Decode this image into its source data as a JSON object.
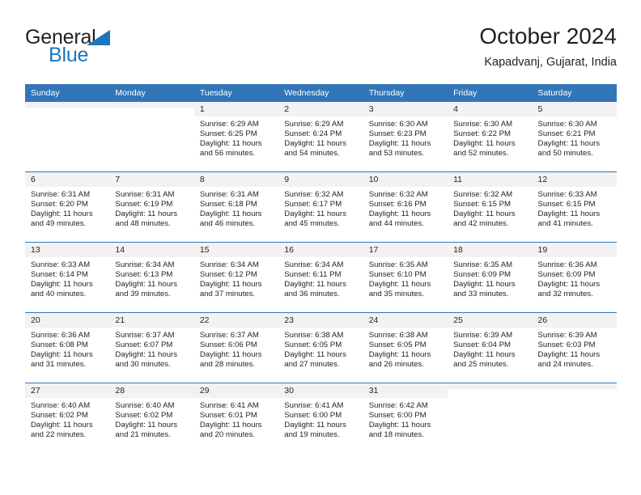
{
  "brand": {
    "name_part1": "General",
    "name_part2": "Blue",
    "accent_color": "#1d76bc",
    "triangle_icon": "brand-triangle-icon"
  },
  "header": {
    "title": "October 2024",
    "subtitle": "Kapadvanj, Gujarat, India"
  },
  "theme": {
    "header_blue": "#3276b8",
    "date_band_gray": "#f2f2f2",
    "text": "#231f20"
  },
  "columns": [
    "Sunday",
    "Monday",
    "Tuesday",
    "Wednesday",
    "Thursday",
    "Friday",
    "Saturday"
  ],
  "weeks": [
    [
      {
        "day": "",
        "empty": true,
        "sunrise": "",
        "sunset": "",
        "daylight1": "",
        "daylight2": ""
      },
      {
        "day": "",
        "empty": true,
        "sunrise": "",
        "sunset": "",
        "daylight1": "",
        "daylight2": ""
      },
      {
        "day": "1",
        "sunrise": "Sunrise: 6:29 AM",
        "sunset": "Sunset: 6:25 PM",
        "daylight1": "Daylight: 11 hours",
        "daylight2": "and 56 minutes."
      },
      {
        "day": "2",
        "sunrise": "Sunrise: 6:29 AM",
        "sunset": "Sunset: 6:24 PM",
        "daylight1": "Daylight: 11 hours",
        "daylight2": "and 54 minutes."
      },
      {
        "day": "3",
        "sunrise": "Sunrise: 6:30 AM",
        "sunset": "Sunset: 6:23 PM",
        "daylight1": "Daylight: 11 hours",
        "daylight2": "and 53 minutes."
      },
      {
        "day": "4",
        "sunrise": "Sunrise: 6:30 AM",
        "sunset": "Sunset: 6:22 PM",
        "daylight1": "Daylight: 11 hours",
        "daylight2": "and 52 minutes."
      },
      {
        "day": "5",
        "sunrise": "Sunrise: 6:30 AM",
        "sunset": "Sunset: 6:21 PM",
        "daylight1": "Daylight: 11 hours",
        "daylight2": "and 50 minutes."
      }
    ],
    [
      {
        "day": "6",
        "sunrise": "Sunrise: 6:31 AM",
        "sunset": "Sunset: 6:20 PM",
        "daylight1": "Daylight: 11 hours",
        "daylight2": "and 49 minutes."
      },
      {
        "day": "7",
        "sunrise": "Sunrise: 6:31 AM",
        "sunset": "Sunset: 6:19 PM",
        "daylight1": "Daylight: 11 hours",
        "daylight2": "and 48 minutes."
      },
      {
        "day": "8",
        "sunrise": "Sunrise: 6:31 AM",
        "sunset": "Sunset: 6:18 PM",
        "daylight1": "Daylight: 11 hours",
        "daylight2": "and 46 minutes."
      },
      {
        "day": "9",
        "sunrise": "Sunrise: 6:32 AM",
        "sunset": "Sunset: 6:17 PM",
        "daylight1": "Daylight: 11 hours",
        "daylight2": "and 45 minutes."
      },
      {
        "day": "10",
        "sunrise": "Sunrise: 6:32 AM",
        "sunset": "Sunset: 6:16 PM",
        "daylight1": "Daylight: 11 hours",
        "daylight2": "and 44 minutes."
      },
      {
        "day": "11",
        "sunrise": "Sunrise: 6:32 AM",
        "sunset": "Sunset: 6:15 PM",
        "daylight1": "Daylight: 11 hours",
        "daylight2": "and 42 minutes."
      },
      {
        "day": "12",
        "sunrise": "Sunrise: 6:33 AM",
        "sunset": "Sunset: 6:15 PM",
        "daylight1": "Daylight: 11 hours",
        "daylight2": "and 41 minutes."
      }
    ],
    [
      {
        "day": "13",
        "sunrise": "Sunrise: 6:33 AM",
        "sunset": "Sunset: 6:14 PM",
        "daylight1": "Daylight: 11 hours",
        "daylight2": "and 40 minutes."
      },
      {
        "day": "14",
        "sunrise": "Sunrise: 6:34 AM",
        "sunset": "Sunset: 6:13 PM",
        "daylight1": "Daylight: 11 hours",
        "daylight2": "and 39 minutes."
      },
      {
        "day": "15",
        "sunrise": "Sunrise: 6:34 AM",
        "sunset": "Sunset: 6:12 PM",
        "daylight1": "Daylight: 11 hours",
        "daylight2": "and 37 minutes."
      },
      {
        "day": "16",
        "sunrise": "Sunrise: 6:34 AM",
        "sunset": "Sunset: 6:11 PM",
        "daylight1": "Daylight: 11 hours",
        "daylight2": "and 36 minutes."
      },
      {
        "day": "17",
        "sunrise": "Sunrise: 6:35 AM",
        "sunset": "Sunset: 6:10 PM",
        "daylight1": "Daylight: 11 hours",
        "daylight2": "and 35 minutes."
      },
      {
        "day": "18",
        "sunrise": "Sunrise: 6:35 AM",
        "sunset": "Sunset: 6:09 PM",
        "daylight1": "Daylight: 11 hours",
        "daylight2": "and 33 minutes."
      },
      {
        "day": "19",
        "sunrise": "Sunrise: 6:36 AM",
        "sunset": "Sunset: 6:09 PM",
        "daylight1": "Daylight: 11 hours",
        "daylight2": "and 32 minutes."
      }
    ],
    [
      {
        "day": "20",
        "sunrise": "Sunrise: 6:36 AM",
        "sunset": "Sunset: 6:08 PM",
        "daylight1": "Daylight: 11 hours",
        "daylight2": "and 31 minutes."
      },
      {
        "day": "21",
        "sunrise": "Sunrise: 6:37 AM",
        "sunset": "Sunset: 6:07 PM",
        "daylight1": "Daylight: 11 hours",
        "daylight2": "and 30 minutes."
      },
      {
        "day": "22",
        "sunrise": "Sunrise: 6:37 AM",
        "sunset": "Sunset: 6:06 PM",
        "daylight1": "Daylight: 11 hours",
        "daylight2": "and 28 minutes."
      },
      {
        "day": "23",
        "sunrise": "Sunrise: 6:38 AM",
        "sunset": "Sunset: 6:05 PM",
        "daylight1": "Daylight: 11 hours",
        "daylight2": "and 27 minutes."
      },
      {
        "day": "24",
        "sunrise": "Sunrise: 6:38 AM",
        "sunset": "Sunset: 6:05 PM",
        "daylight1": "Daylight: 11 hours",
        "daylight2": "and 26 minutes."
      },
      {
        "day": "25",
        "sunrise": "Sunrise: 6:39 AM",
        "sunset": "Sunset: 6:04 PM",
        "daylight1": "Daylight: 11 hours",
        "daylight2": "and 25 minutes."
      },
      {
        "day": "26",
        "sunrise": "Sunrise: 6:39 AM",
        "sunset": "Sunset: 6:03 PM",
        "daylight1": "Daylight: 11 hours",
        "daylight2": "and 24 minutes."
      }
    ],
    [
      {
        "day": "27",
        "sunrise": "Sunrise: 6:40 AM",
        "sunset": "Sunset: 6:02 PM",
        "daylight1": "Daylight: 11 hours",
        "daylight2": "and 22 minutes."
      },
      {
        "day": "28",
        "sunrise": "Sunrise: 6:40 AM",
        "sunset": "Sunset: 6:02 PM",
        "daylight1": "Daylight: 11 hours",
        "daylight2": "and 21 minutes."
      },
      {
        "day": "29",
        "sunrise": "Sunrise: 6:41 AM",
        "sunset": "Sunset: 6:01 PM",
        "daylight1": "Daylight: 11 hours",
        "daylight2": "and 20 minutes."
      },
      {
        "day": "30",
        "sunrise": "Sunrise: 6:41 AM",
        "sunset": "Sunset: 6:00 PM",
        "daylight1": "Daylight: 11 hours",
        "daylight2": "and 19 minutes."
      },
      {
        "day": "31",
        "sunrise": "Sunrise: 6:42 AM",
        "sunset": "Sunset: 6:00 PM",
        "daylight1": "Daylight: 11 hours",
        "daylight2": "and 18 minutes."
      },
      {
        "day": "",
        "empty": true,
        "sunrise": "",
        "sunset": "",
        "daylight1": "",
        "daylight2": ""
      },
      {
        "day": "",
        "empty": true,
        "sunrise": "",
        "sunset": "",
        "daylight1": "",
        "daylight2": ""
      }
    ]
  ]
}
